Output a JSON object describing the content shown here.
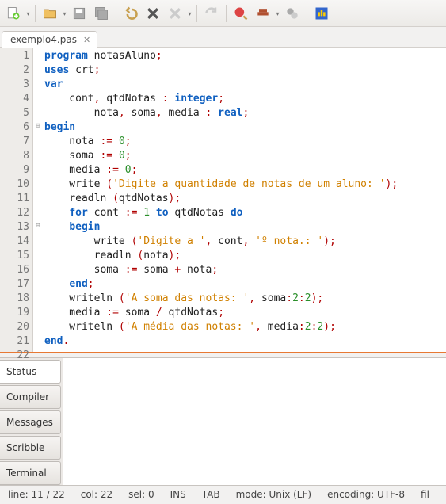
{
  "toolbar": {
    "icons": [
      "new-file",
      "open-file",
      "save",
      "save-all",
      "undo",
      "close",
      "delete",
      "redo-arrow",
      "run-ball",
      "stack",
      "step",
      "gears",
      "stop-hand"
    ]
  },
  "tab": {
    "label": "exemplo4.pas"
  },
  "code": {
    "lines": [
      [
        [
          "kw",
          "program"
        ],
        [
          "id",
          " notasAluno"
        ],
        [
          "pun",
          ";"
        ]
      ],
      [
        [
          "kw",
          "uses"
        ],
        [
          "id",
          " crt"
        ],
        [
          "pun",
          ";"
        ]
      ],
      [
        [
          "kw",
          "var"
        ]
      ],
      [
        [
          "id",
          "    cont"
        ],
        [
          "pun",
          ","
        ],
        [
          "id",
          " qtdNotas "
        ],
        [
          "pun",
          ":"
        ],
        [
          "id",
          " "
        ],
        [
          "kw",
          "integer"
        ],
        [
          "pun",
          ";"
        ]
      ],
      [
        [
          "id",
          "        nota"
        ],
        [
          "pun",
          ","
        ],
        [
          "id",
          " soma"
        ],
        [
          "pun",
          ","
        ],
        [
          "id",
          " media "
        ],
        [
          "pun",
          ":"
        ],
        [
          "id",
          " "
        ],
        [
          "kw",
          "real"
        ],
        [
          "pun",
          ";"
        ]
      ],
      [
        [
          "kw",
          "begin"
        ]
      ],
      [
        [
          "id",
          "    nota "
        ],
        [
          "pun",
          ":="
        ],
        [
          "id",
          " "
        ],
        [
          "num",
          "0"
        ],
        [
          "pun",
          ";"
        ]
      ],
      [
        [
          "id",
          "    soma "
        ],
        [
          "pun",
          ":="
        ],
        [
          "id",
          " "
        ],
        [
          "num",
          "0"
        ],
        [
          "pun",
          ";"
        ]
      ],
      [
        [
          "id",
          "    media "
        ],
        [
          "pun",
          ":="
        ],
        [
          "id",
          " "
        ],
        [
          "num",
          "0"
        ],
        [
          "pun",
          ";"
        ]
      ],
      [
        [
          "id",
          "    write "
        ],
        [
          "pun",
          "("
        ],
        [
          "str",
          "'Digite a quantidade de notas de um aluno: '"
        ],
        [
          "pun",
          ")"
        ],
        [
          "pun",
          ";"
        ]
      ],
      [
        [
          "id",
          "    readln "
        ],
        [
          "pun",
          "("
        ],
        [
          "id",
          "qtdNotas"
        ],
        [
          "pun",
          ")"
        ],
        [
          "pun",
          ";"
        ]
      ],
      [
        [
          "id",
          "    "
        ],
        [
          "kw",
          "for"
        ],
        [
          "id",
          " cont "
        ],
        [
          "pun",
          ":="
        ],
        [
          "id",
          " "
        ],
        [
          "num",
          "1"
        ],
        [
          "id",
          " "
        ],
        [
          "kw",
          "to"
        ],
        [
          "id",
          " qtdNotas "
        ],
        [
          "kw",
          "do"
        ]
      ],
      [
        [
          "id",
          "    "
        ],
        [
          "kw",
          "begin"
        ]
      ],
      [
        [
          "id",
          "        write "
        ],
        [
          "pun",
          "("
        ],
        [
          "str",
          "'Digite a '"
        ],
        [
          "pun",
          ","
        ],
        [
          "id",
          " cont"
        ],
        [
          "pun",
          ","
        ],
        [
          "id",
          " "
        ],
        [
          "str",
          "'º nota.: '"
        ],
        [
          "pun",
          ")"
        ],
        [
          "pun",
          ";"
        ]
      ],
      [
        [
          "id",
          "        readln "
        ],
        [
          "pun",
          "("
        ],
        [
          "id",
          "nota"
        ],
        [
          "pun",
          ")"
        ],
        [
          "pun",
          ";"
        ]
      ],
      [
        [
          "id",
          "        soma "
        ],
        [
          "pun",
          ":="
        ],
        [
          "id",
          " soma "
        ],
        [
          "pun",
          "+"
        ],
        [
          "id",
          " nota"
        ],
        [
          "pun",
          ";"
        ]
      ],
      [
        [
          "id",
          "    "
        ],
        [
          "kw",
          "end"
        ],
        [
          "pun",
          ";"
        ]
      ],
      [
        [
          "id",
          "    writeln "
        ],
        [
          "pun",
          "("
        ],
        [
          "str",
          "'A soma das notas: '"
        ],
        [
          "pun",
          ","
        ],
        [
          "id",
          " soma"
        ],
        [
          "pun",
          ":"
        ],
        [
          "num",
          "2"
        ],
        [
          "pun",
          ":"
        ],
        [
          "num",
          "2"
        ],
        [
          "pun",
          ")"
        ],
        [
          "pun",
          ";"
        ]
      ],
      [
        [
          "id",
          "    media "
        ],
        [
          "pun",
          ":="
        ],
        [
          "id",
          " soma "
        ],
        [
          "pun",
          "/"
        ],
        [
          "id",
          " qtdNotas"
        ],
        [
          "pun",
          ";"
        ]
      ],
      [
        [
          "id",
          "    writeln "
        ],
        [
          "pun",
          "("
        ],
        [
          "str",
          "'A média das notas: '"
        ],
        [
          "pun",
          ","
        ],
        [
          "id",
          " media"
        ],
        [
          "pun",
          ":"
        ],
        [
          "num",
          "2"
        ],
        [
          "pun",
          ":"
        ],
        [
          "num",
          "2"
        ],
        [
          "pun",
          ")"
        ],
        [
          "pun",
          ";"
        ]
      ],
      [
        [
          "kw",
          "end"
        ],
        [
          "pun",
          "."
        ]
      ],
      [
        [
          "id",
          ""
        ]
      ]
    ],
    "fold": {
      "6": "⊟",
      "13": "⊟"
    }
  },
  "panel": {
    "tabs": [
      "Status",
      "Compiler",
      "Messages",
      "Scribble",
      "Terminal"
    ],
    "active": 0
  },
  "status": {
    "line": "line: 11 / 22",
    "col": "col: 22",
    "sel": "sel: 0",
    "ins": "INS",
    "tab": "TAB",
    "mode": "mode: Unix (LF)",
    "enc": "encoding: UTF-8",
    "file": "fil"
  }
}
